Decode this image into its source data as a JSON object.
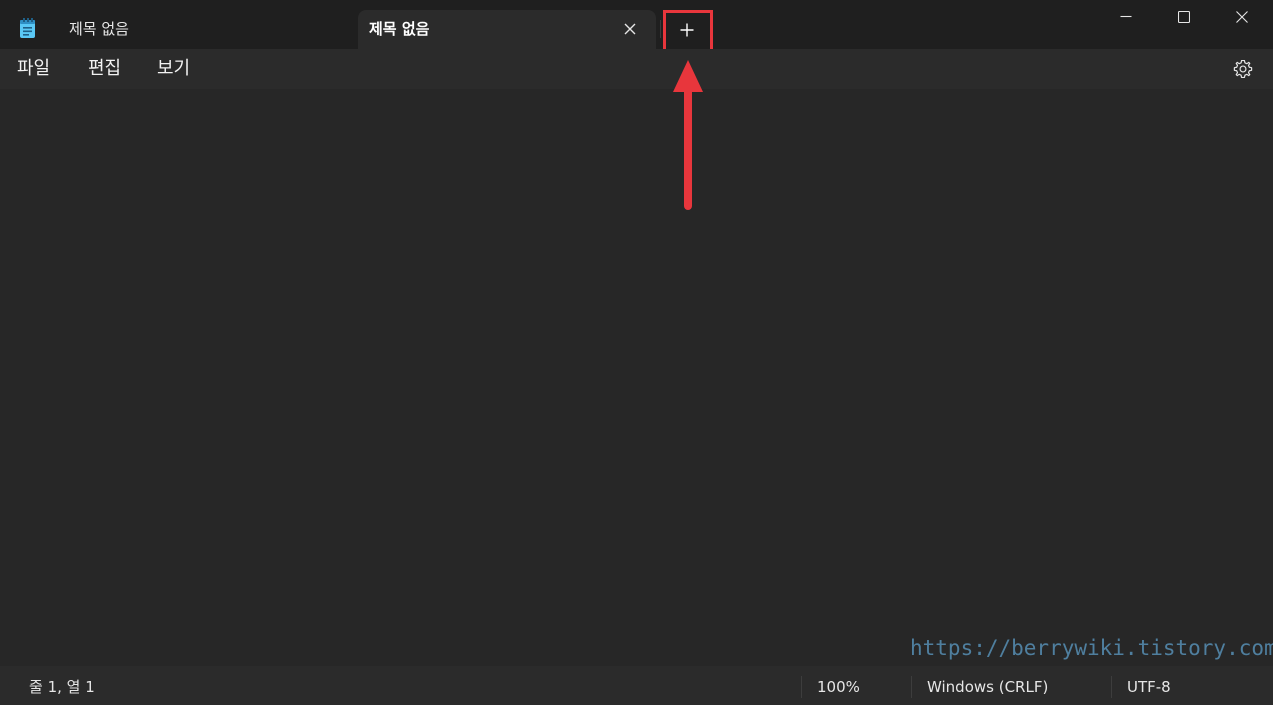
{
  "tabs": [
    {
      "title": "제목 없음",
      "active": false
    },
    {
      "title": "제목 없음",
      "active": true
    }
  ],
  "icons": {
    "app": "notepad-icon",
    "tab_close": "close-icon",
    "new_tab": "plus-icon",
    "minimize": "minimize-icon",
    "maximize": "maximize-icon",
    "close_window": "close-icon",
    "settings": "gear-icon"
  },
  "menu": {
    "file": "파일",
    "edit": "편집",
    "view": "보기"
  },
  "editor": {
    "content": ""
  },
  "watermark": "https://berrywiki.tistory.com",
  "status": {
    "position": "줄 1, 열 1",
    "zoom": "100%",
    "line_ending": "Windows (CRLF)",
    "encoding": "UTF-8"
  },
  "colors": {
    "titlebar": "#1f1f1f",
    "active_tab": "#2b2b2b",
    "editor_bg": "#272727",
    "annotation": "#e8363c",
    "app_icon": "#4fc3f7"
  }
}
